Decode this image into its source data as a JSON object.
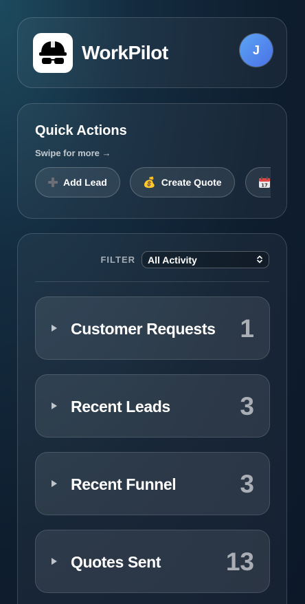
{
  "app": {
    "name": "WorkPilot",
    "avatar_initial": "J"
  },
  "quick_actions": {
    "title": "Quick Actions",
    "hint": "Swipe for more →",
    "items": [
      {
        "icon": "plus-icon",
        "glyph": "➕",
        "label": "Add Lead"
      },
      {
        "icon": "money-bag-icon",
        "glyph": "💰",
        "label": "Create Quote"
      },
      {
        "icon": "calendar-icon",
        "glyph": "📅",
        "label": ""
      }
    ]
  },
  "activity": {
    "filter_label": "FILTER",
    "filter_value": "All Activity",
    "sections": [
      {
        "title": "Customer Requests",
        "count": "1"
      },
      {
        "title": "Recent Leads",
        "count": "3"
      },
      {
        "title": "Recent Funnel",
        "count": "3"
      },
      {
        "title": "Quotes Sent",
        "count": "13"
      }
    ]
  },
  "colors": {
    "avatar_gradient_start": "#5ca4f5",
    "avatar_gradient_end": "#4a72e6",
    "background": "#0e1d2e"
  }
}
